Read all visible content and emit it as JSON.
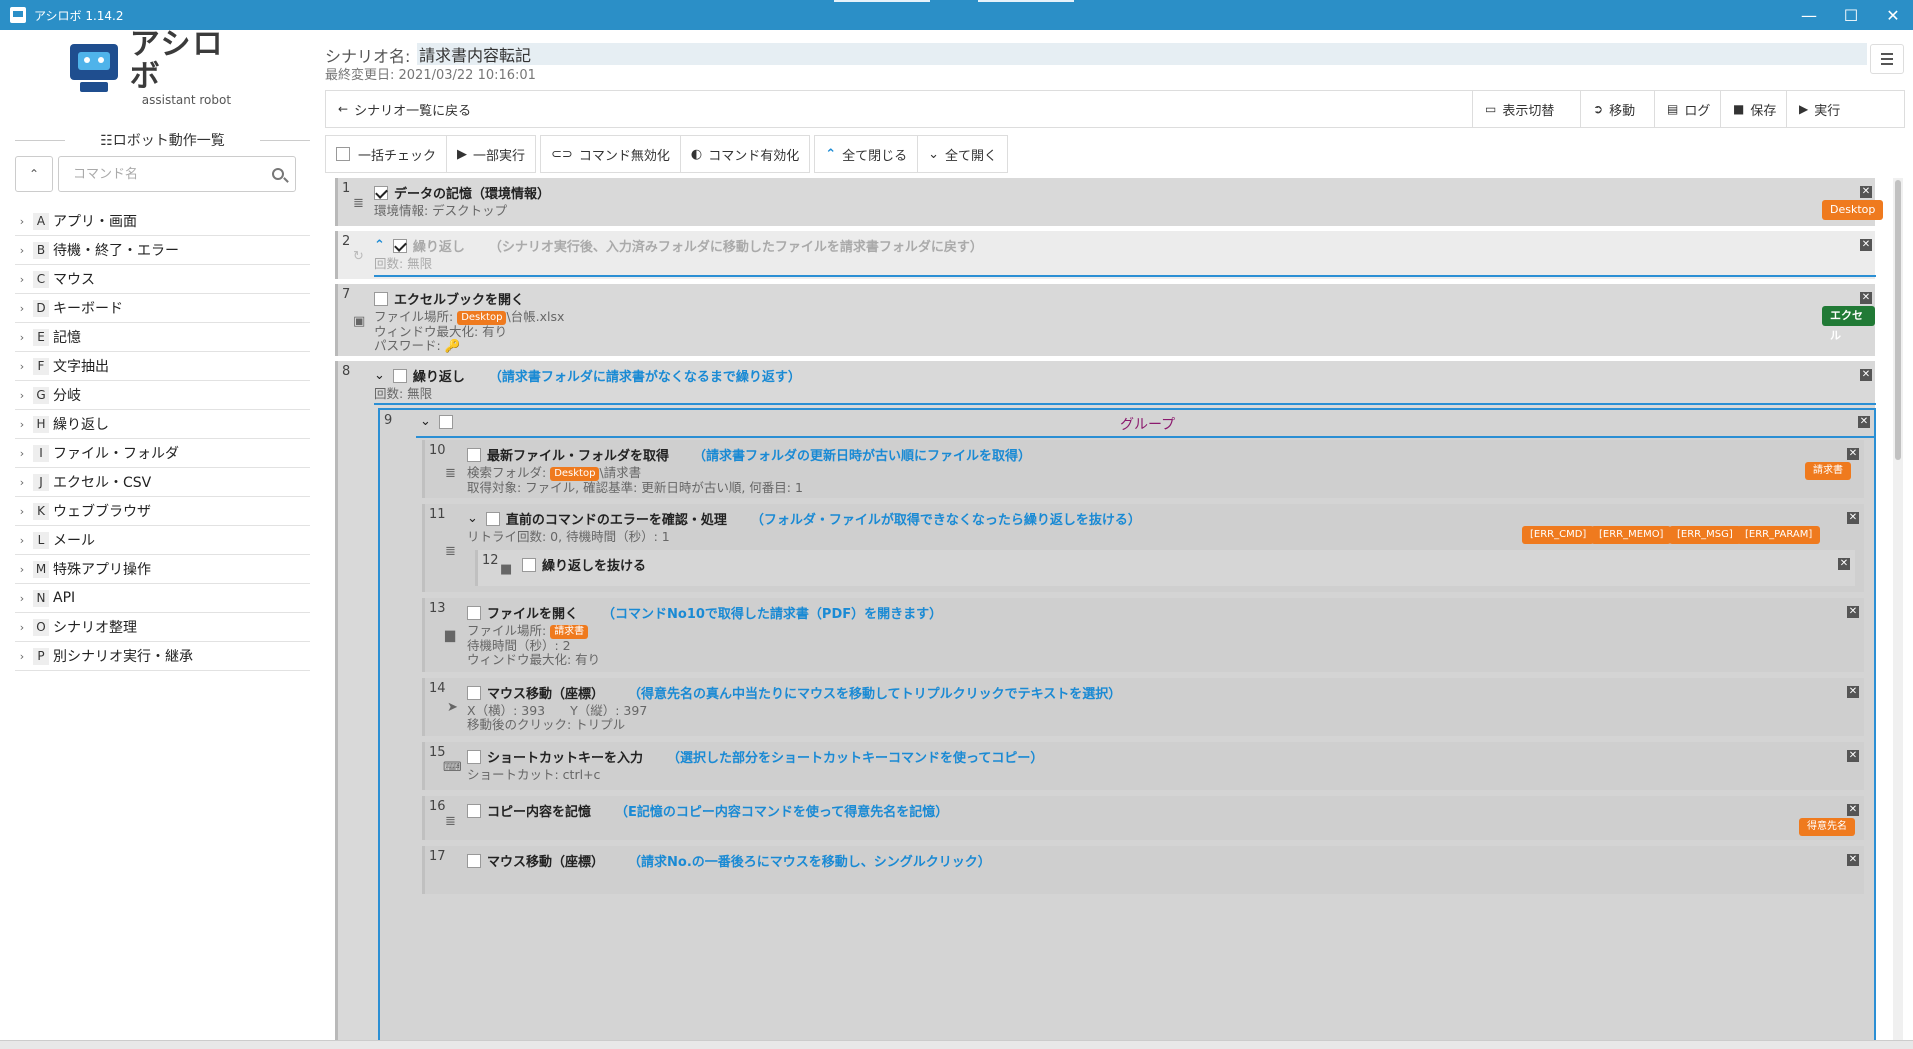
{
  "window": {
    "title": "アシロボ 1.14.2"
  },
  "logo": {
    "jp": "アシロボ",
    "en": "assistant robot"
  },
  "sidebar": {
    "section_title": "☷ロボット動作一覧",
    "search_placeholder": "コマンド名",
    "categories": [
      {
        "letter": "A",
        "label": "アプリ・画面"
      },
      {
        "letter": "B",
        "label": "待機・終了・エラー"
      },
      {
        "letter": "C",
        "label": "マウス"
      },
      {
        "letter": "D",
        "label": "キーボード"
      },
      {
        "letter": "E",
        "label": "記憶"
      },
      {
        "letter": "F",
        "label": "文字抽出"
      },
      {
        "letter": "G",
        "label": "分岐"
      },
      {
        "letter": "H",
        "label": "繰り返し"
      },
      {
        "letter": "I",
        "label": "ファイル・フォルダ"
      },
      {
        "letter": "J",
        "label": "エクセル・CSV"
      },
      {
        "letter": "K",
        "label": "ウェブブラウザ"
      },
      {
        "letter": "L",
        "label": "メール"
      },
      {
        "letter": "M",
        "label": "特殊アプリ操作"
      },
      {
        "letter": "N",
        "label": "API"
      },
      {
        "letter": "O",
        "label": "シナリオ整理"
      },
      {
        "letter": "P",
        "label": "別シナリオ実行・継承"
      }
    ]
  },
  "header": {
    "scenario_label": "シナリオ名:",
    "scenario_name": "請求書内容転記",
    "last_modified": "最終変更日: 2021/03/22 10:16:01"
  },
  "toolbar1": {
    "back": "シナリオ一覧に戻る",
    "toggle_view": "表示切替",
    "move": "移動",
    "log": "ログ",
    "save": "保存",
    "run": "実行"
  },
  "toolbar2": {
    "check_all": "一括チェック",
    "partial_run": "一部実行",
    "disable_cmd": "コマンド無効化",
    "enable_cmd": "コマンド有効化",
    "close_all": "全て閉じる",
    "open_all": "全て開く"
  },
  "steps": {
    "s1": {
      "num": "1",
      "cmd": "データの記憶（環境情報）",
      "line1": "環境情報: デスクトップ",
      "badge": "Desktop"
    },
    "s2": {
      "num": "2",
      "cmd": "繰り返し",
      "memo": "（シナリオ実行後、入力済みフォルダに移動したファイルを請求書フォルダに戻す）",
      "line1": "回数: 無限"
    },
    "s7": {
      "num": "7",
      "cmd": "エクセルブックを開く",
      "line1_pre": "ファイル場所: ",
      "tag": "Desktop",
      "line1_post": "\\台帳.xlsx",
      "line2": "ウィンドウ最大化: 有り",
      "line3": "パスワード:",
      "badge": "エクセル"
    },
    "s8": {
      "num": "8",
      "cmd": "繰り返し",
      "memo": "（請求書フォルダに請求書がなくなるまで繰り返す）",
      "line1": "回数: 無限"
    },
    "s9": {
      "num": "9",
      "title": "グループ"
    },
    "s10": {
      "num": "10",
      "cmd": "最新ファイル・フォルダを取得",
      "memo": "（請求書フォルダの更新日時が古い順にファイルを取得）",
      "line1_pre": "検索フォルダ: ",
      "tag": "Desktop",
      "line1_post": "\\請求書",
      "line2": "取得対象: ファイル, 確認基準: 更新日時が古い順, 何番目: 1",
      "badge": "請求書"
    },
    "s11": {
      "num": "11",
      "cmd": "直前のコマンドのエラーを確認・処理",
      "memo": "（フォルダ・ファイルが取得できなくなったら繰り返しを抜ける）",
      "line1": "リトライ回数: 0, 待機時間（秒）: 1",
      "badges": [
        "[ERR_CMD]",
        "[ERR_MEMO]",
        "[ERR_MSG]",
        "[ERR_PARAM]"
      ]
    },
    "s12": {
      "num": "12",
      "cmd": "繰り返しを抜ける"
    },
    "s13": {
      "num": "13",
      "cmd": "ファイルを開く",
      "memo": "（コマンドNo10で取得した請求書（PDF）を開きます）",
      "line1_pre": "ファイル場所: ",
      "tag": "請求書",
      "line2": "待機時間（秒）: 2",
      "line3": "ウィンドウ最大化: 有り"
    },
    "s14": {
      "num": "14",
      "cmd": "マウス移動（座標）",
      "memo": "（得意先名の真ん中当たりにマウスを移動してトリプルクリックでテキストを選択）",
      "line1": "X（横）: 393　　Y（縦）: 397",
      "line2": "移動後のクリック: トリプル"
    },
    "s15": {
      "num": "15",
      "cmd": "ショートカットキーを入力",
      "memo": "（選択した部分をショートカットキーコマンドを使ってコピー）",
      "line1": "ショートカット: ctrl+c"
    },
    "s16": {
      "num": "16",
      "cmd": "コピー内容を記憶",
      "memo": "（E記憶のコピー内容コマンドを使って得意先名を記憶）",
      "badge": "得意先名"
    },
    "s17": {
      "num": "17",
      "cmd": "マウス移動（座標）",
      "memo": "（請求No.の一番後ろにマウスを移動し、シングルクリック）"
    }
  },
  "colors": {
    "titlebar": "#2b8fc7",
    "memo": "#1a8ad4",
    "tag_orange": "#ef7a1e",
    "tag_green": "#217a36",
    "group_title": "#8b1a6e"
  }
}
